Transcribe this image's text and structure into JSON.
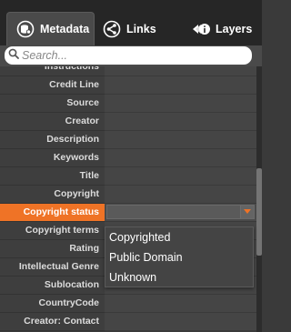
{
  "tabs": [
    {
      "label": "Metadata",
      "icon": "metadata-icon",
      "active": true
    },
    {
      "label": "Links",
      "icon": "share-icon",
      "active": false
    },
    {
      "label": "Layers",
      "icon": "layers-icon",
      "active": false
    }
  ],
  "search": {
    "placeholder": "Search..."
  },
  "fields": [
    {
      "label": "Instructions"
    },
    {
      "label": "Credit Line"
    },
    {
      "label": "Source"
    },
    {
      "label": "Creator"
    },
    {
      "label": "Description"
    },
    {
      "label": "Keywords"
    },
    {
      "label": "Title"
    },
    {
      "label": "Copyright"
    },
    {
      "label": "Copyright status"
    },
    {
      "label": "Copyright terms"
    },
    {
      "label": "Rating"
    },
    {
      "label": "Intellectual Genre"
    },
    {
      "label": "Sublocation"
    },
    {
      "label": "CountryCode"
    },
    {
      "label": "Creator: Contact"
    }
  ],
  "copyright_status_dropdown": {
    "options": [
      "Copyrighted",
      "Public Domain",
      "Unknown"
    ]
  },
  "colors": {
    "accent": "#ef7326",
    "panel": "#3a3a3a",
    "tabbar": "#262626"
  }
}
